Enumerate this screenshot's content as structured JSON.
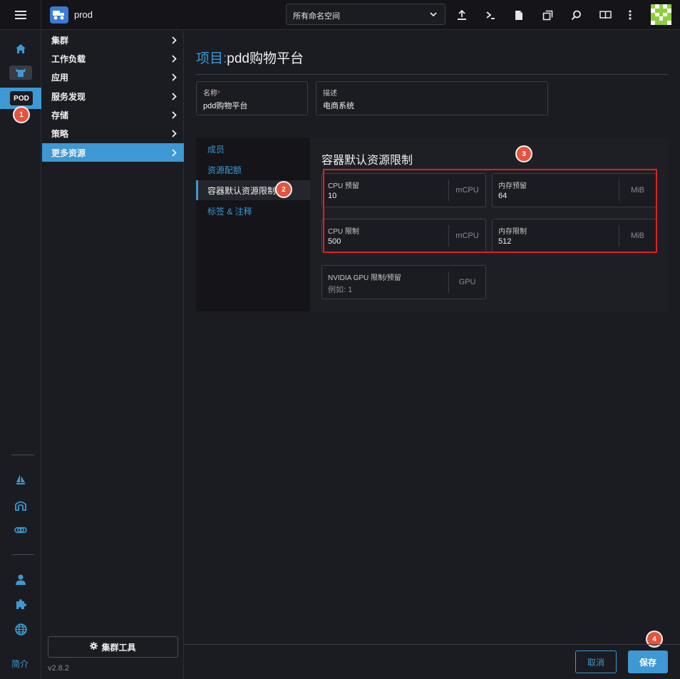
{
  "header": {
    "cluster_name": "prod",
    "namespace_select": "所有命名空间",
    "toolbar_icons": [
      "upload-icon",
      "terminal-icon",
      "file-icon",
      "copy-icon",
      "search-icon",
      "book-icon",
      "more-vertical-icon"
    ]
  },
  "rail": {
    "pod_badge": "POD",
    "footer_link": "简介"
  },
  "nav": {
    "items": [
      {
        "label": "集群"
      },
      {
        "label": "工作负载"
      },
      {
        "label": "应用"
      },
      {
        "label": "服务发现"
      },
      {
        "label": "存储"
      },
      {
        "label": "策略"
      },
      {
        "label": "更多资源",
        "active": true
      }
    ],
    "tools_button": "集群工具",
    "version": "v2.8.2"
  },
  "main": {
    "title_prefix": "项目:",
    "title_name": "pdd购物平台",
    "name_field": {
      "label": "名称",
      "required": "*",
      "value": "pdd购物平台"
    },
    "desc_field": {
      "label": "描述",
      "value": "电商系统"
    },
    "tabs": [
      {
        "label": "成员"
      },
      {
        "label": "资源配额"
      },
      {
        "label": "容器默认资源限制",
        "active": true
      },
      {
        "label": "标签 & 注释"
      }
    ],
    "section_title": "容器默认资源限制",
    "resources": {
      "cpu_reserve": {
        "label": "CPU 预留",
        "value": "10",
        "unit": "mCPU"
      },
      "mem_reserve": {
        "label": "内存预留",
        "value": "64",
        "unit": "MiB"
      },
      "cpu_limit": {
        "label": "CPU 限制",
        "value": "500",
        "unit": "mCPU"
      },
      "mem_limit": {
        "label": "内存限制",
        "value": "512",
        "unit": "MiB"
      },
      "gpu": {
        "label": "NVIDIA GPU 限制/预留",
        "placeholder": "例如: 1",
        "unit": "GPU"
      }
    }
  },
  "markers": [
    "1",
    "2",
    "3",
    "4"
  ],
  "footer": {
    "cancel": "取消",
    "save": "保存"
  },
  "colors": {
    "accent": "#3d98d3",
    "marker": "#e6533c",
    "highlight": "#e01f1f"
  }
}
